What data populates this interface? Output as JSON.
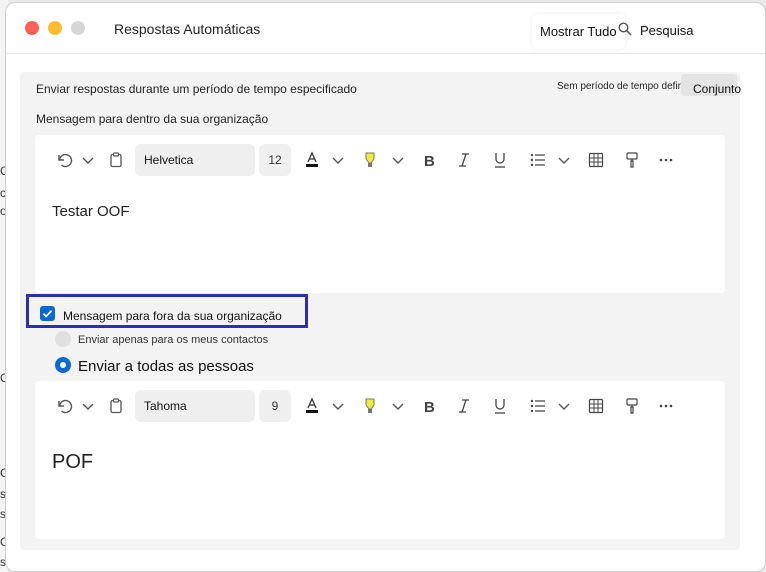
{
  "window": {
    "title": "Respostas Automáticas",
    "show_all_label": "Mostrar Tudo",
    "search_label": "Pesquisa"
  },
  "background_fragments": [
    "C",
    "c",
    "o",
    "C",
    "C",
    "s.",
    "s",
    "C",
    "s"
  ],
  "period": {
    "label": "Enviar respostas durante um período de tempo especificado",
    "none_label": "Sem período de tempo definido",
    "set_button": "Conjunto"
  },
  "inside": {
    "label": "Mensagem para dentro da sua organização",
    "font": "Helvetica",
    "size": "12",
    "body": "Testar OOF"
  },
  "outside": {
    "checkbox_label": "Mensagem para fora da sua organização",
    "checked": true,
    "option_contacts": "Enviar apenas para os meus contactos",
    "option_all": "Enviar a todas as pessoas",
    "selected_option": "Enviar a todas as pessoas",
    "font": "Tahoma",
    "size": "9",
    "body": "POF"
  },
  "colors": {
    "accent": "#0a69d6",
    "highlight_border": "#2b2fb3",
    "highlighter": "#f4e83a"
  },
  "toolbar_icons": [
    "undo-icon",
    "chevron-down-icon",
    "clipboard-icon",
    "font-color-icon",
    "highlighter-icon",
    "bold-icon",
    "italic-icon",
    "underline-icon",
    "bullet-list-icon",
    "table-icon",
    "format-painter-icon",
    "more-icon"
  ]
}
